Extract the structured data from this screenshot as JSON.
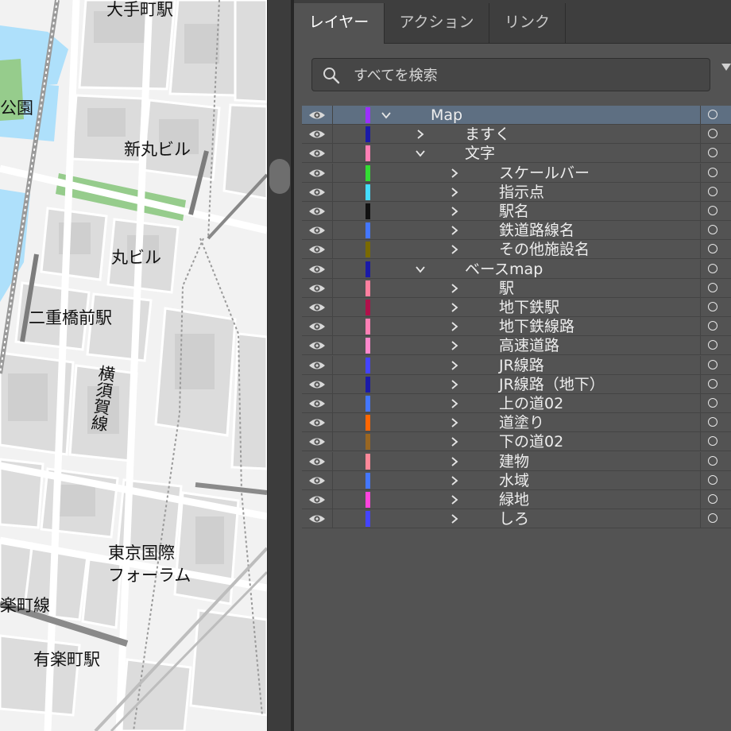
{
  "map": {
    "labels": [
      {
        "id": "ote-machi",
        "text": "大手町駅"
      },
      {
        "id": "park",
        "text": "公園"
      },
      {
        "id": "shin-maru",
        "text": "新丸ビル"
      },
      {
        "id": "maru",
        "text": "丸ビル"
      },
      {
        "id": "nijubashi",
        "text": "二重橋前駅"
      },
      {
        "id": "yokosuka",
        "text": "横須賀線"
      },
      {
        "id": "forum-1",
        "text": "東京国際"
      },
      {
        "id": "forum-2",
        "text": "フォーラム"
      },
      {
        "id": "yurakucho-line",
        "text": "楽町線"
      },
      {
        "id": "yurakucho-st",
        "text": "有楽町駅"
      }
    ]
  },
  "panel": {
    "tabs": [
      {
        "label": "レイヤー",
        "active": true
      },
      {
        "label": "アクション",
        "active": false
      },
      {
        "label": "リンク",
        "active": false
      }
    ],
    "search": {
      "placeholder": "すべてを検索"
    },
    "layers": [
      {
        "name": "Map",
        "level": 0,
        "expanded": true,
        "color": "#9b30ff",
        "selected": true
      },
      {
        "name": "ますく",
        "level": 1,
        "expanded": false,
        "color": "#1a1aa8"
      },
      {
        "name": "文字",
        "level": 1,
        "expanded": true,
        "color": "#ff7fb5"
      },
      {
        "name": "スケールバー",
        "level": 2,
        "expanded": false,
        "color": "#33dd33"
      },
      {
        "name": "指示点",
        "level": 2,
        "expanded": false,
        "color": "#44ddff"
      },
      {
        "name": "駅名",
        "level": 2,
        "expanded": false,
        "color": "#111111"
      },
      {
        "name": "鉄道路線名",
        "level": 2,
        "expanded": false,
        "color": "#4477ff"
      },
      {
        "name": "その他施設名",
        "level": 2,
        "expanded": false,
        "color": "#7a6a00"
      },
      {
        "name": "ベースmap",
        "level": 1,
        "expanded": true,
        "color": "#1a1aa8"
      },
      {
        "name": "駅",
        "level": 2,
        "expanded": false,
        "color": "#ff7f9f"
      },
      {
        "name": "地下鉄駅",
        "level": 2,
        "expanded": false,
        "color": "#b0104a"
      },
      {
        "name": "地下鉄線路",
        "level": 2,
        "expanded": false,
        "color": "#ff7fb5"
      },
      {
        "name": "高速道路",
        "level": 2,
        "expanded": false,
        "color": "#ff88cc"
      },
      {
        "name": "JR線路",
        "level": 2,
        "expanded": false,
        "color": "#4444ff"
      },
      {
        "name": "JR線路（地下）",
        "level": 2,
        "expanded": false,
        "color": "#1a1aa8"
      },
      {
        "name": "上の道02",
        "level": 2,
        "expanded": false,
        "color": "#4477ff"
      },
      {
        "name": "道塗り",
        "level": 2,
        "expanded": false,
        "color": "#ff6600"
      },
      {
        "name": "下の道02",
        "level": 2,
        "expanded": false,
        "color": "#996622"
      },
      {
        "name": "建物",
        "level": 2,
        "expanded": false,
        "color": "#ff8899"
      },
      {
        "name": "水域",
        "level": 2,
        "expanded": false,
        "color": "#4477ff"
      },
      {
        "name": "緑地",
        "level": 2,
        "expanded": false,
        "color": "#ff44dd"
      },
      {
        "name": "しろ",
        "level": 2,
        "expanded": false,
        "color": "#4444ff"
      }
    ]
  }
}
